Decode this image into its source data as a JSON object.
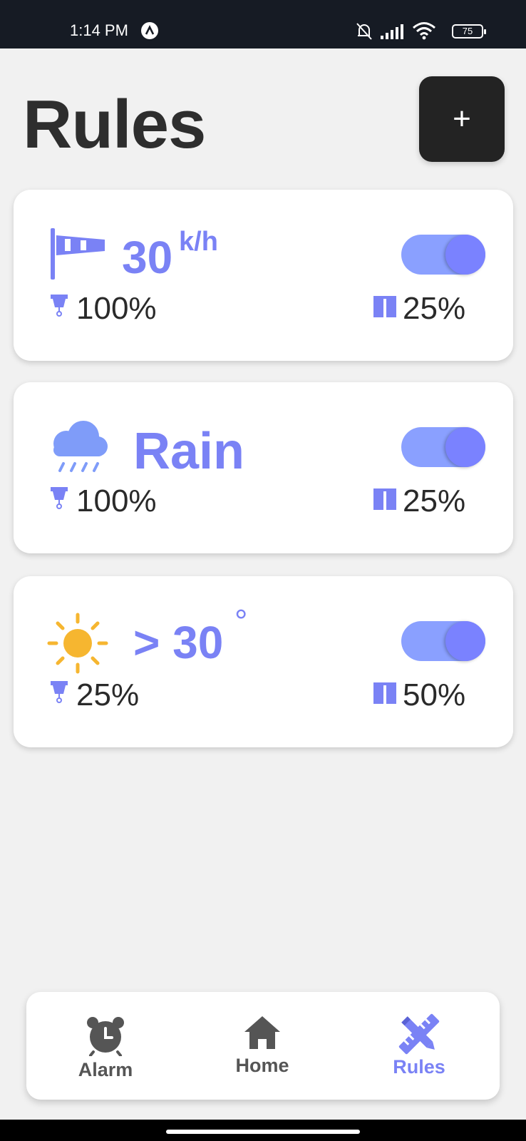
{
  "status_bar": {
    "time": "1:14 PM",
    "battery": "75",
    "icons": [
      "app-notification-icon",
      "bell-off-icon",
      "signal-icon",
      "wifi-icon",
      "battery-icon"
    ]
  },
  "header": {
    "title": "Rules",
    "add_label": "+"
  },
  "colors": {
    "accent": "#7a82f5",
    "toggle_track": "#8aa0ff",
    "toggle_knob": "#7a82ff",
    "sun": "#f6b630",
    "cloud": "#7f9cf9",
    "text_dark": "#2a2a2a"
  },
  "rules": [
    {
      "condition_icon": "windsock-icon",
      "condition_value": "30",
      "condition_unit": "k/h",
      "enabled": true,
      "awning_value": "100%",
      "shutter_value": "25%"
    },
    {
      "condition_icon": "rain-cloud-icon",
      "condition_value": "Rain",
      "condition_unit": "",
      "enabled": true,
      "awning_value": "100%",
      "shutter_value": "25%"
    },
    {
      "condition_icon": "sun-icon",
      "condition_value": "> 30",
      "condition_unit": "°",
      "enabled": true,
      "awning_value": "25%",
      "shutter_value": "50%"
    }
  ],
  "bottom_nav": {
    "items": [
      {
        "label": "Alarm",
        "icon": "alarm-clock-icon",
        "active": false
      },
      {
        "label": "Home",
        "icon": "home-icon",
        "active": false
      },
      {
        "label": "Rules",
        "icon": "pencil-ruler-icon",
        "active": true
      }
    ]
  }
}
